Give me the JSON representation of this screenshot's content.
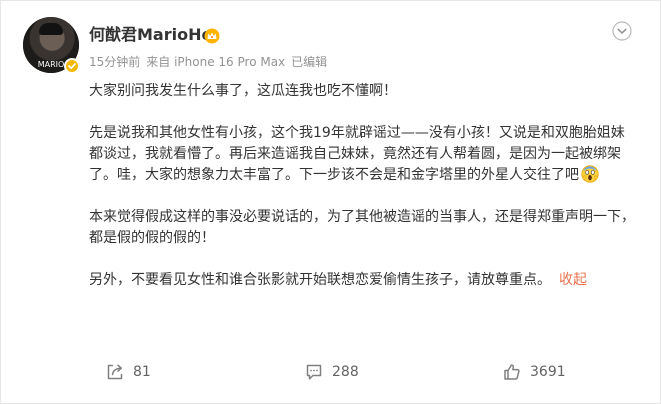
{
  "post": {
    "user": {
      "name": "何猷君MarioHo",
      "avatar_tag": "MARIO"
    },
    "meta": {
      "time": "15分钟前",
      "source": "来自 iPhone 16 Pro Max",
      "edited": "已编辑"
    },
    "paragraphs": [
      "大家别问我发生什么事了，这瓜连我也吃不懂啊！",
      "先是说我和其他女性有小孩，这个我19年就辟谣过——没有小孩！又说是和双胞胎姐妹都谈过，我就看懵了。再后来造谣我自己妹妹，竟然还有人帮着圆，是因为一起被绑架了。哇，大家的想象力太丰富了。下一步该不会是和金字塔里的外星人交往了吧",
      "本来觉得假成这样的事没必要说话的，为了其他被造谣的当事人，还是得郑重声明一下，都是假的假的假的！",
      "另外，不要看见女性和谁合张影就开始联想恋爱偷情生孩子，请放尊重点。"
    ],
    "collapse_label": "收起",
    "actions": {
      "repost_count": "81",
      "comment_count": "288",
      "like_count": "3691"
    },
    "icons": {
      "verify": "verified-badge-icon",
      "crown": "crown-icon",
      "more": "chevron-down-icon",
      "emoji": "screaming-face-emoji",
      "repost": "repost-icon",
      "comment": "comment-icon",
      "like": "thumbs-up-icon"
    },
    "colors": {
      "accent": "#eb7350",
      "verify": "#f6b800",
      "meta_text": "#939393"
    }
  }
}
